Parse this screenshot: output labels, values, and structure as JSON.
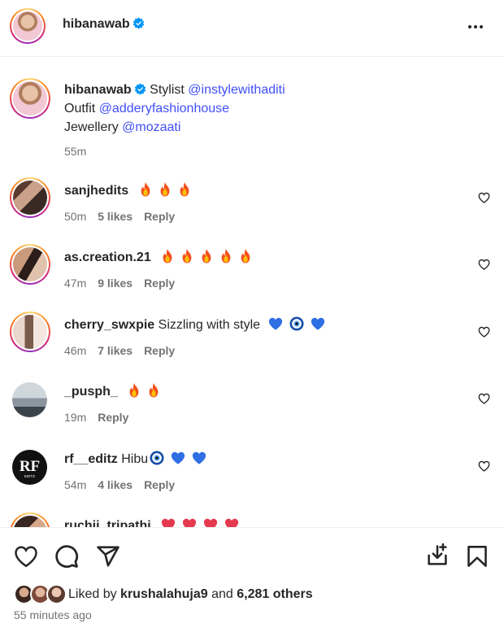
{
  "header": {
    "username": "hibanawab"
  },
  "caption": {
    "username": "hibanawab",
    "line1_prefix": "Stylist",
    "line1_mention": "@instylewithaditi",
    "line2_prefix": "Outfit",
    "line2_mention": "@adderyfashionhouse",
    "line3_prefix": "Jewellery",
    "line3_mention": "@mozaati",
    "time": "55m"
  },
  "comments": [
    {
      "username": "sanjhedits",
      "text": "",
      "emojis": [
        "fire",
        "fire",
        "fire"
      ],
      "time": "50m",
      "likes": "5 likes",
      "reply": "Reply"
    },
    {
      "username": "as.creation.21",
      "text": "",
      "emojis": [
        "fire",
        "fire",
        "fire",
        "fire",
        "fire"
      ],
      "time": "47m",
      "likes": "9 likes",
      "reply": "Reply"
    },
    {
      "username": "cherry_swxpie",
      "text": "Sizzling with style",
      "emojis": [
        "blue-heart",
        "nazar",
        "blue-heart"
      ],
      "time": "46m",
      "likes": "7 likes",
      "reply": "Reply"
    },
    {
      "username": "_pusph_",
      "text": "",
      "emojis": [
        "fire",
        "fire"
      ],
      "time": "19m",
      "likes": "",
      "reply": "Reply"
    },
    {
      "username": "rf__editz",
      "text": "Hibu",
      "emojis": [
        "nazar",
        "blue-heart",
        "blue-heart"
      ],
      "time": "54m",
      "likes": "4 likes",
      "reply": "Reply"
    },
    {
      "username": "ruchii_tripathi",
      "text": "",
      "emojis": [
        "red-heart",
        "red-heart",
        "red-heart",
        "red-heart"
      ],
      "time": "",
      "likes": "",
      "reply": ""
    }
  ],
  "rf_avatar": {
    "logo_text": "RF",
    "sub_text": "EDITZ"
  },
  "footer": {
    "liked_by_prefix": "Liked by",
    "liked_by_user": "krushalahuja9",
    "and_text": "and",
    "others": "6,281 others",
    "time_ago": "55 minutes ago"
  },
  "icons": {
    "verified": "verified-badge-icon",
    "more": "more-options-icon",
    "like": "heart-icon",
    "comment": "comment-icon",
    "share": "share-icon",
    "save_to_collection": "save-download-icon",
    "bookmark": "bookmark-icon"
  },
  "colors": {
    "verified": "#0095f6",
    "mention": "#4150f7",
    "meta": "#737373"
  }
}
